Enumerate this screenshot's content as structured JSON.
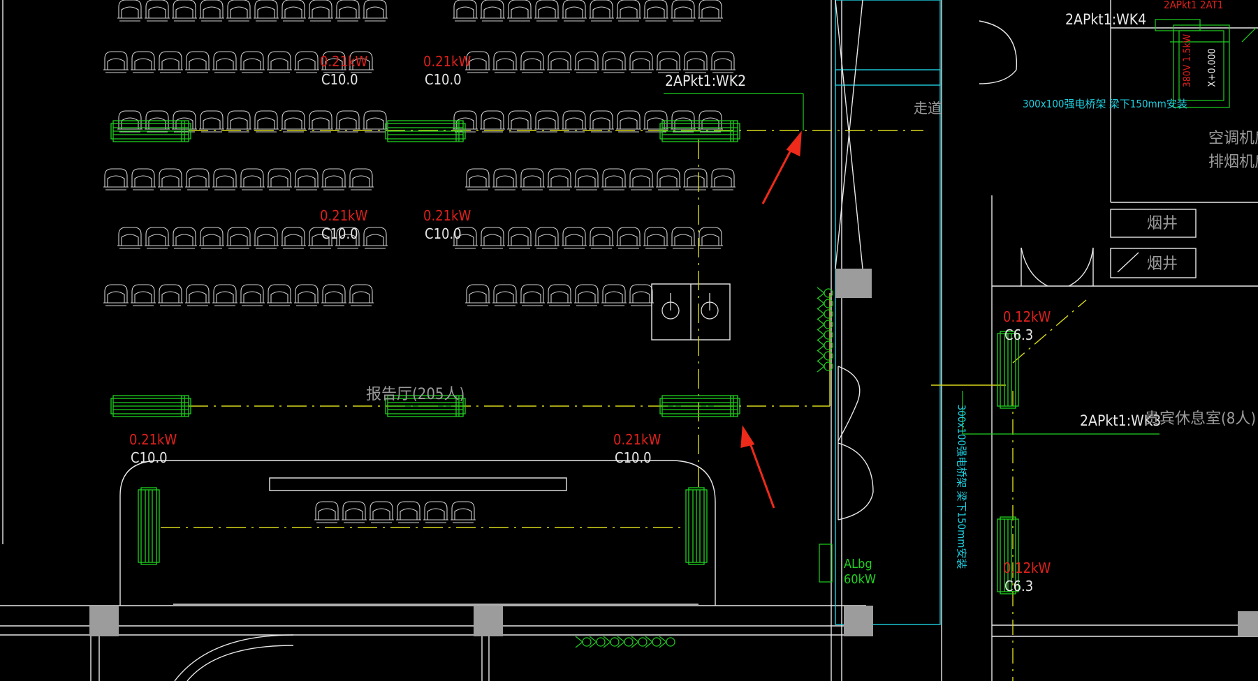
{
  "loads": [
    {
      "kw": "0.21kW",
      "breaker": "C10.0"
    },
    {
      "kw": "0.21kW",
      "breaker": "C10.0"
    },
    {
      "kw": "0.21kW",
      "breaker": "C10.0"
    },
    {
      "kw": "0.21kW",
      "breaker": "C10.0"
    },
    {
      "kw": "0.21kW",
      "breaker": "C10.0"
    },
    {
      "kw": "0.21kW",
      "breaker": "C10.0"
    },
    {
      "kw": "0.12kW",
      "breaker": "C6.3"
    },
    {
      "kw": "0.12kW",
      "breaker": "C6.3"
    }
  ],
  "circuits": {
    "wk2": "2APkt1:WK2",
    "wk3": "2APkt1:WK3",
    "wk4": "2APkt1:WK4",
    "top_right_partial": "2APkt1  2AT1"
  },
  "rooms": {
    "hall": "报告厅(205人)",
    "vip_lounge": "贵宾休息室(8人)",
    "corridor": "走道",
    "ac_room": "空调机房",
    "smoke_room": "排烟机房",
    "smoke_shaft_1": "烟井",
    "smoke_shaft_2": "烟井"
  },
  "tray_notes": {
    "horizontal": "300x100强电桥架 梁下150mm安装",
    "vertical": "300x100强电桥架 梁下150mm安装"
  },
  "panel": {
    "name": "ALbg",
    "power": "60kW"
  },
  "fan_label": {
    "spec": "380V 1.5kW",
    "height": "X+0.000"
  },
  "colors": {
    "background": "#000000",
    "walls": "#e8e8e8",
    "equipment": "#1fd11f",
    "circuit": "#d8d81a",
    "tray": "#1ecfe0",
    "load_text": "#e0201c",
    "arrow": "#ee2a1a"
  }
}
